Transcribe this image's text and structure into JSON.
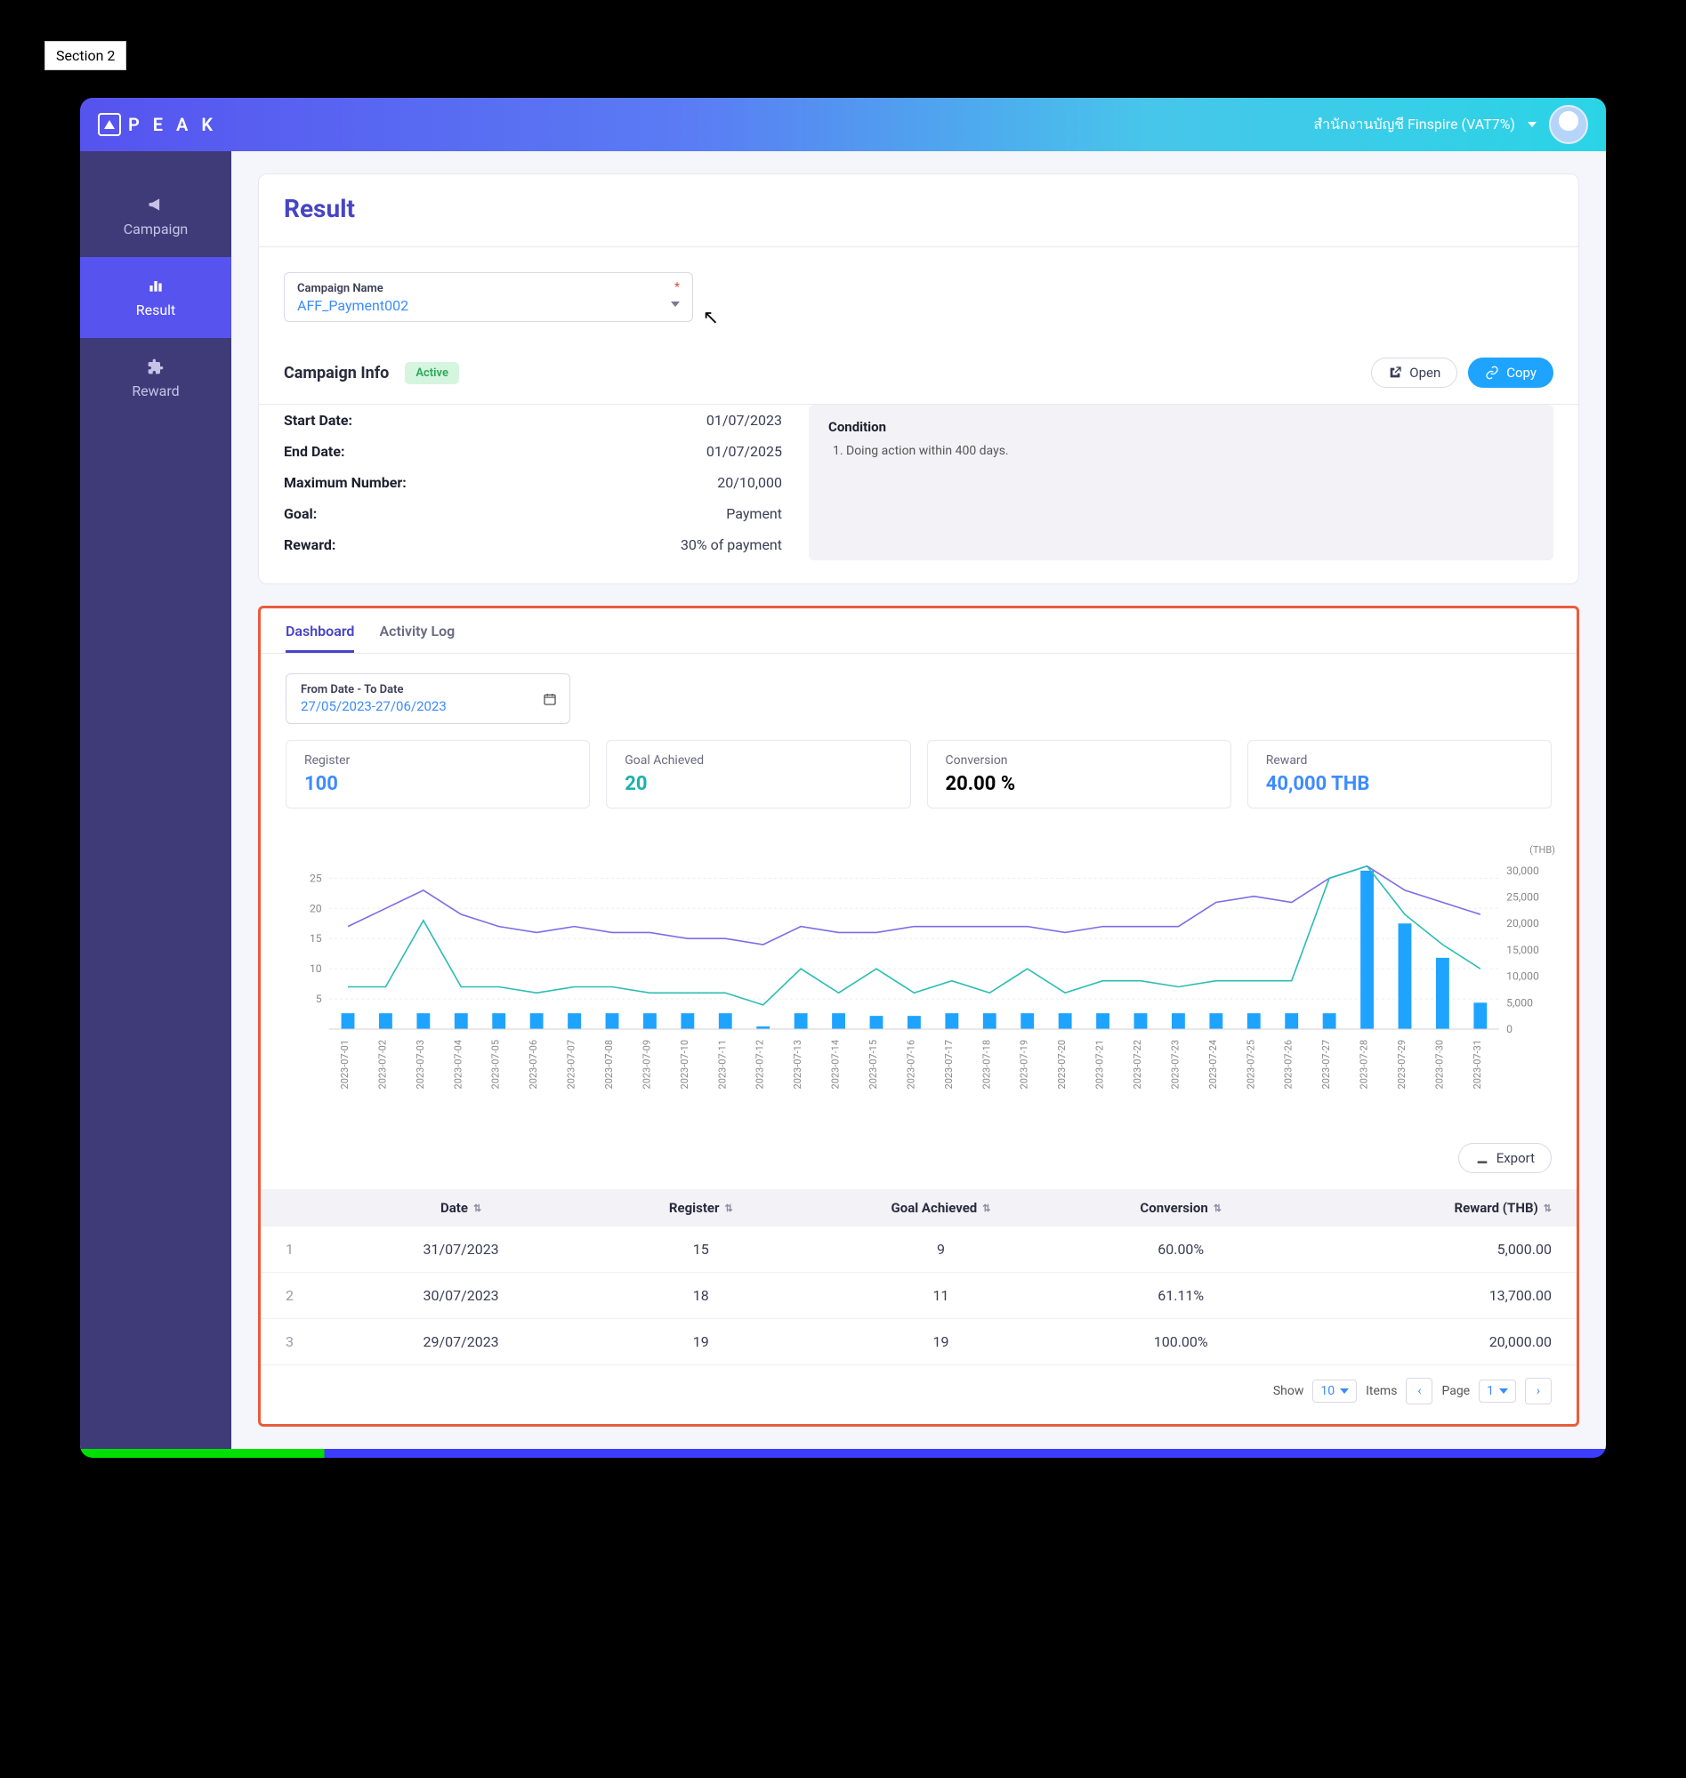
{
  "section_tag": "Section 2",
  "header": {
    "logo_text": "P E A K",
    "org_label": "สำนักงานบัญชี Finspire (VAT7%)"
  },
  "sidebar": {
    "items": [
      {
        "id": "campaign",
        "label": "Campaign",
        "icon": "megaphone-icon"
      },
      {
        "id": "result",
        "label": "Result",
        "icon": "bar-chart-icon"
      },
      {
        "id": "reward",
        "label": "Reward",
        "icon": "puzzle-icon"
      }
    ],
    "active": "result"
  },
  "page": {
    "title": "Result",
    "campaign_dd": {
      "label": "Campaign Name",
      "value": "AFF_Payment002"
    },
    "info_head": {
      "title": "Campaign Info",
      "status": "Active",
      "open_btn": "Open",
      "copy_btn": "Copy"
    },
    "info_rows": [
      {
        "label": "Start Date:",
        "value": "01/07/2023"
      },
      {
        "label": "End Date:",
        "value": "01/07/2025"
      },
      {
        "label": "Maximum Number:",
        "value": "20/10,000"
      },
      {
        "label": "Goal:",
        "value": "Payment"
      },
      {
        "label": "Reward:",
        "value": "30% of payment"
      }
    ],
    "condition": {
      "title": "Condition",
      "items": [
        "Doing action within 400 days."
      ]
    }
  },
  "dashboard": {
    "tabs": {
      "dashboard": "Dashboard",
      "activity": "Activity Log"
    },
    "date_label": "From Date - To Date",
    "date_value": "27/05/2023-27/06/2023",
    "kpis": [
      {
        "label": "Register",
        "value": "100",
        "tone": "blue"
      },
      {
        "label": "Goal Achieved",
        "value": "20",
        "tone": "teal"
      },
      {
        "label": "Conversion",
        "value": "20.00 %",
        "tone": "plain"
      },
      {
        "label": "Reward",
        "value": "40,000 THB",
        "tone": "blue"
      }
    ],
    "export_btn": "Export",
    "table": {
      "columns": [
        "Date",
        "Register",
        "Goal Achieved",
        "Conversion",
        "Reward (THB)"
      ],
      "rows": [
        {
          "idx": "1",
          "date": "31/07/2023",
          "register": "15",
          "goal": "9",
          "conv": "60.00%",
          "reward": "5,000.00"
        },
        {
          "idx": "2",
          "date": "30/07/2023",
          "register": "18",
          "goal": "11",
          "conv": "61.11%",
          "reward": "13,700.00"
        },
        {
          "idx": "3",
          "date": "29/07/2023",
          "register": "19",
          "goal": "19",
          "conv": "100.00%",
          "reward": "20,000.00"
        }
      ]
    },
    "pager": {
      "show_label": "Show",
      "show_val": "10",
      "items_label": "Items",
      "page_label": "Page",
      "page_val": "1"
    }
  },
  "chart_data": {
    "type": "combo",
    "right_axis_label": "(THB)",
    "y_left_ticks": [
      5,
      10,
      15,
      20,
      25
    ],
    "y_left_range": [
      0,
      28
    ],
    "y_right_ticks": [
      0,
      5000,
      10000,
      15000,
      20000,
      25000,
      30000
    ],
    "y_right_range": [
      0,
      32000
    ],
    "categories": [
      "2023-07-01",
      "2023-07-02",
      "2023-07-03",
      "2023-07-04",
      "2023-07-05",
      "2023-07-06",
      "2023-07-07",
      "2023-07-08",
      "2023-07-09",
      "2023-07-10",
      "2023-07-11",
      "2023-07-12",
      "2023-07-13",
      "2023-07-14",
      "2023-07-15",
      "2023-07-16",
      "2023-07-17",
      "2023-07-18",
      "2023-07-19",
      "2023-07-20",
      "2023-07-21",
      "2023-07-22",
      "2023-07-23",
      "2023-07-24",
      "2023-07-25",
      "2023-07-26",
      "2023-07-27",
      "2023-07-28",
      "2023-07-29",
      "2023-07-30",
      "2023-07-31"
    ],
    "series": [
      {
        "name": "Register",
        "type": "line",
        "color": "#7c6de6",
        "values": [
          17,
          20,
          23,
          19,
          17,
          16,
          17,
          16,
          16,
          15,
          15,
          14,
          17,
          16,
          16,
          17,
          17,
          17,
          17,
          16,
          17,
          17,
          17,
          21,
          22,
          21,
          25,
          27,
          23,
          21,
          19
        ]
      },
      {
        "name": "Goal Achieved",
        "type": "line",
        "color": "#2abdb4",
        "values": [
          7,
          7,
          18,
          7,
          7,
          6,
          7,
          7,
          6,
          6,
          6,
          4,
          10,
          6,
          10,
          6,
          8,
          6,
          10,
          6,
          8,
          8,
          7,
          8,
          8,
          8,
          25,
          27,
          19,
          14,
          10
        ]
      },
      {
        "name": "Reward (THB)",
        "type": "bar",
        "color": "#1ea4ff",
        "values": [
          3000,
          3000,
          3000,
          3000,
          3000,
          3000,
          3000,
          3000,
          3000,
          3000,
          3000,
          500,
          3000,
          3000,
          2500,
          2500,
          3000,
          3000,
          3000,
          3000,
          3000,
          3000,
          3000,
          3000,
          3000,
          3000,
          3000,
          30000,
          20000,
          13500,
          5000
        ]
      }
    ]
  }
}
